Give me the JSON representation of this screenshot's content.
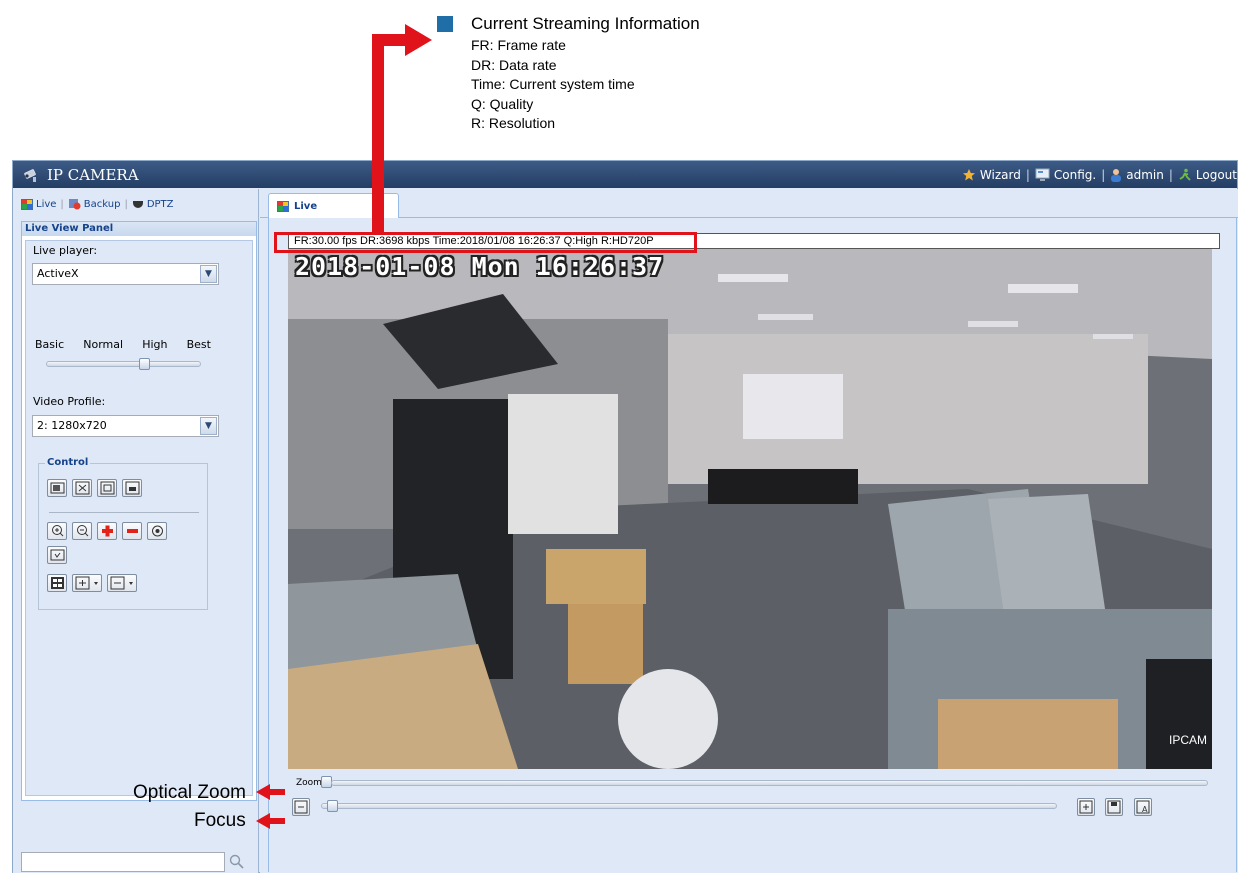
{
  "annotation": {
    "title": "Current Streaming Information",
    "lines": [
      "FR: Frame rate",
      "DR: Data rate",
      "Time: Current system time",
      "Q: Quality",
      "R: Resolution"
    ],
    "optical_zoom_label": "Optical Zoom",
    "focus_label": "Focus",
    "arrow_color": "#e0121a",
    "legend_color": "#1f6ea8"
  },
  "app": {
    "title": "IP CAMERA",
    "header_links": {
      "wizard": "Wizard",
      "config": "Config.",
      "admin": "admin",
      "logout": "Logout"
    }
  },
  "left_panel": {
    "tabs": {
      "live": "Live",
      "backup": "Backup",
      "dptz": "DPTZ"
    },
    "panel_title": "Live View Panel",
    "live_player_label": "Live player:",
    "live_player_value": "ActiveX",
    "quality_labels": [
      "Basic",
      "Normal",
      "High",
      "Best"
    ],
    "quality_selected": "High",
    "video_profile_label": "Video Profile:",
    "video_profile_value": "2: 1280x720",
    "control_label": "Control",
    "search_placeholder": ""
  },
  "main": {
    "tab_label": "Live",
    "stream_info": "FR:30.00 fps  DR:3698 kbps Time:2018/01/08 16:26:37 Q:High R:HD720P",
    "osd_timestamp": "2018-01-08 Mon 16:26:37",
    "osd_brand": "IPCAM",
    "zoom_label": "Zoom",
    "zoom_level": 0,
    "focus_level": 0.02
  }
}
